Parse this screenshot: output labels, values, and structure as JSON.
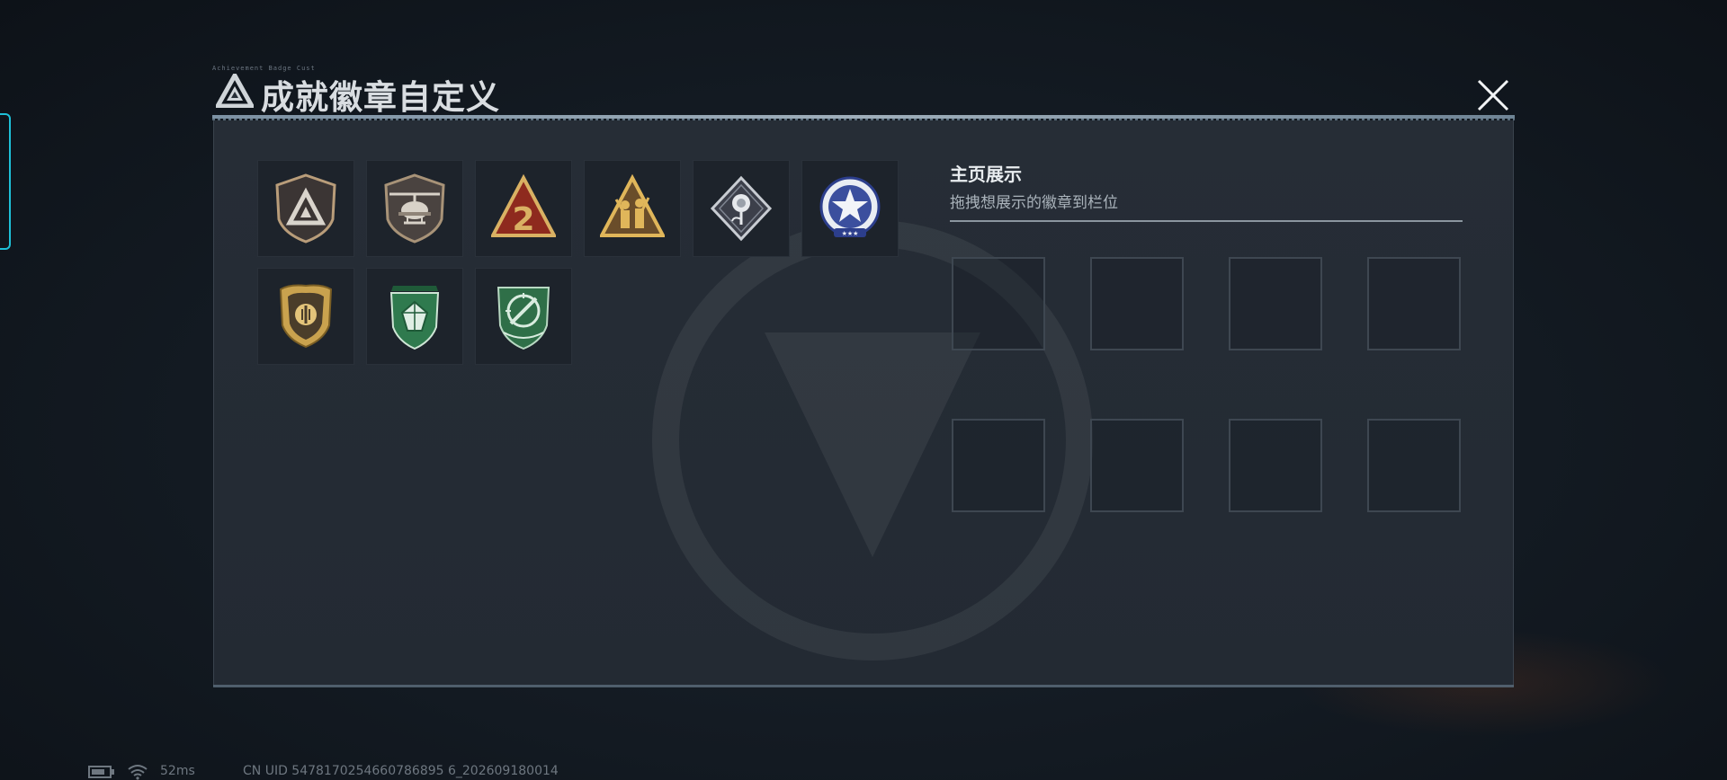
{
  "header": {
    "micro_text": "Achievement Badge Cust",
    "title": "成就徽章自定义",
    "close_icon": "close-icon"
  },
  "badges": [
    {
      "name": "triangle-shield-badge",
      "icon": "triangle-emblem"
    },
    {
      "name": "helicopter-badge",
      "icon": "helicopter"
    },
    {
      "name": "red-number-2-badge",
      "icon": "number-2-triangle"
    },
    {
      "name": "soldiers-triangle-badge",
      "icon": "soldiers"
    },
    {
      "name": "rose-diamond-badge",
      "icon": "rose"
    },
    {
      "name": "blue-star-badge",
      "icon": "star-seal"
    },
    {
      "name": "gold-shield-badge",
      "icon": "shield-emblem"
    },
    {
      "name": "green-gem-badge",
      "icon": "gem-shield"
    },
    {
      "name": "green-knife-badge",
      "icon": "knife-crosshair"
    }
  ],
  "showcase": {
    "title": "主页展示",
    "subtitle": "拖拽想展示的徽章到栏位",
    "slots": [
      {
        "empty": true
      },
      {
        "empty": true
      },
      {
        "empty": true
      },
      {
        "empty": true
      },
      {
        "empty": true
      },
      {
        "empty": true
      },
      {
        "empty": true
      },
      {
        "empty": true
      }
    ]
  },
  "status_bar": {
    "ping": "52ms",
    "uid": "CN UID 5478170254660786895 6_202609180014"
  },
  "colors": {
    "accent_cyan": "#1ec0d8",
    "panel_bg": "#262d36",
    "gold": "#c9a24e",
    "green": "#2f7a4e",
    "badge_red": "#8e2a1e"
  }
}
